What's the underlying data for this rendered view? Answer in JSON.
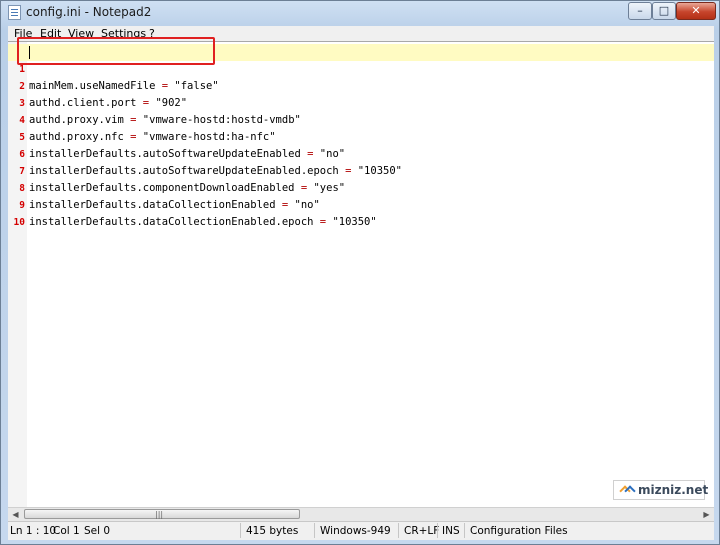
{
  "window": {
    "title": "config.ini - Notepad2"
  },
  "controls": {
    "minimize": "–",
    "maximize": "□",
    "close": "✕"
  },
  "menu": [
    "File",
    "Edit",
    "View",
    "Settings",
    "?"
  ],
  "editor": {
    "lines": [
      {
        "num": "1",
        "key": "mainMem.useNamedFile",
        "op": " = ",
        "val": "\"false\""
      },
      {
        "num": "2",
        "key": "authd.client.port",
        "op": " = ",
        "val": "\"902\""
      },
      {
        "num": "3",
        "key": "authd.proxy.vim",
        "op": " = ",
        "val": "\"vmware-hostd:hostd-vmdb\""
      },
      {
        "num": "4",
        "key": "authd.proxy.nfc",
        "op": " = ",
        "val": "\"vmware-hostd:ha-nfc\""
      },
      {
        "num": "5",
        "key": "installerDefaults.autoSoftwareUpdateEnabled",
        "op": " = ",
        "val": "\"no\""
      },
      {
        "num": "6",
        "key": "installerDefaults.autoSoftwareUpdateEnabled.epoch",
        "op": " = ",
        "val": "\"10350\""
      },
      {
        "num": "7",
        "key": "installerDefaults.componentDownloadEnabled",
        "op": " = ",
        "val": "\"yes\""
      },
      {
        "num": "8",
        "key": "installerDefaults.dataCollectionEnabled",
        "op": " = ",
        "val": "\"no\""
      },
      {
        "num": "9",
        "key": "installerDefaults.dataCollectionEnabled.epoch",
        "op": " = ",
        "val": "\"10350\""
      },
      {
        "num": "10",
        "key": "",
        "op": "",
        "val": ""
      }
    ]
  },
  "watermark": {
    "text": "mizniz.net"
  },
  "scrollbar": {
    "left": "◀",
    "right": "▶",
    "grip": "|||"
  },
  "status": {
    "position": "Ln 1 : 10",
    "column": "Col 1",
    "selection": "Sel 0",
    "size": "415 bytes",
    "encoding": "Windows-949",
    "line_endings": "CR+LF",
    "mode": "INS",
    "scheme": "Configuration Files"
  },
  "colors": {
    "line_number": "#d40000",
    "operator": "#b00000",
    "current_line": "#fffbc2",
    "annotation": "#e02020"
  }
}
